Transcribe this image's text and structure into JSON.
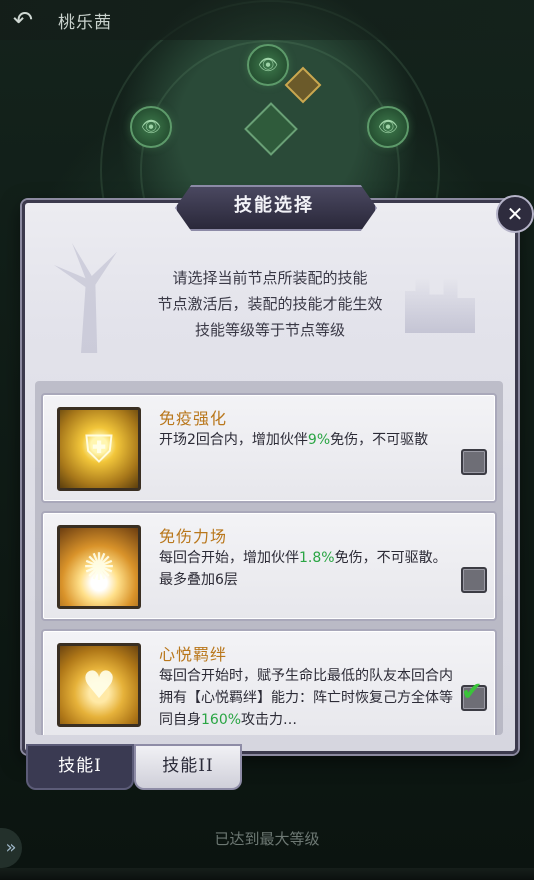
{
  "topbar": {
    "back_icon": "back-arrow-icon",
    "hero_name": "桃乐茜"
  },
  "dialog": {
    "title": "技能选择",
    "close_icon": "close-icon",
    "intro_lines": [
      "请选择当前节点所装配的技能",
      "节点激活后，装配的技能才能生效",
      "技能等级等于节点等级"
    ]
  },
  "skills": [
    {
      "name": "免疫强化",
      "icon": "shield-icon",
      "desc_parts": [
        "开场2回合内，增加伙伴",
        "9%",
        "免伤，不可驱散"
      ],
      "selected": false
    },
    {
      "name": "免伤力场",
      "icon": "force-field-icon",
      "desc_parts": [
        "每回合开始，增加伙伴",
        "1.8%",
        "免伤，不可驱散。最多叠加6层"
      ],
      "selected": false
    },
    {
      "name": "心悦羁绊",
      "icon": "heart-hand-icon",
      "desc_parts": [
        "每回合开始时，赋予生命比最低的队友本回合内拥有【心悦羁绊】能力：阵亡时恢复己方全体等同自身",
        "160%",
        "攻击力…"
      ],
      "selected": true
    }
  ],
  "tabs": {
    "skill_1": "技能I",
    "skill_2": "技能II",
    "active": "skill_2"
  },
  "bottom": {
    "status": "已达到最大等级",
    "side_icon": "double-chevron-right-icon"
  },
  "colors": {
    "skill_name": "#b9771c",
    "highlight_value": "#2aa544",
    "checkmark": "#3ac43a"
  }
}
